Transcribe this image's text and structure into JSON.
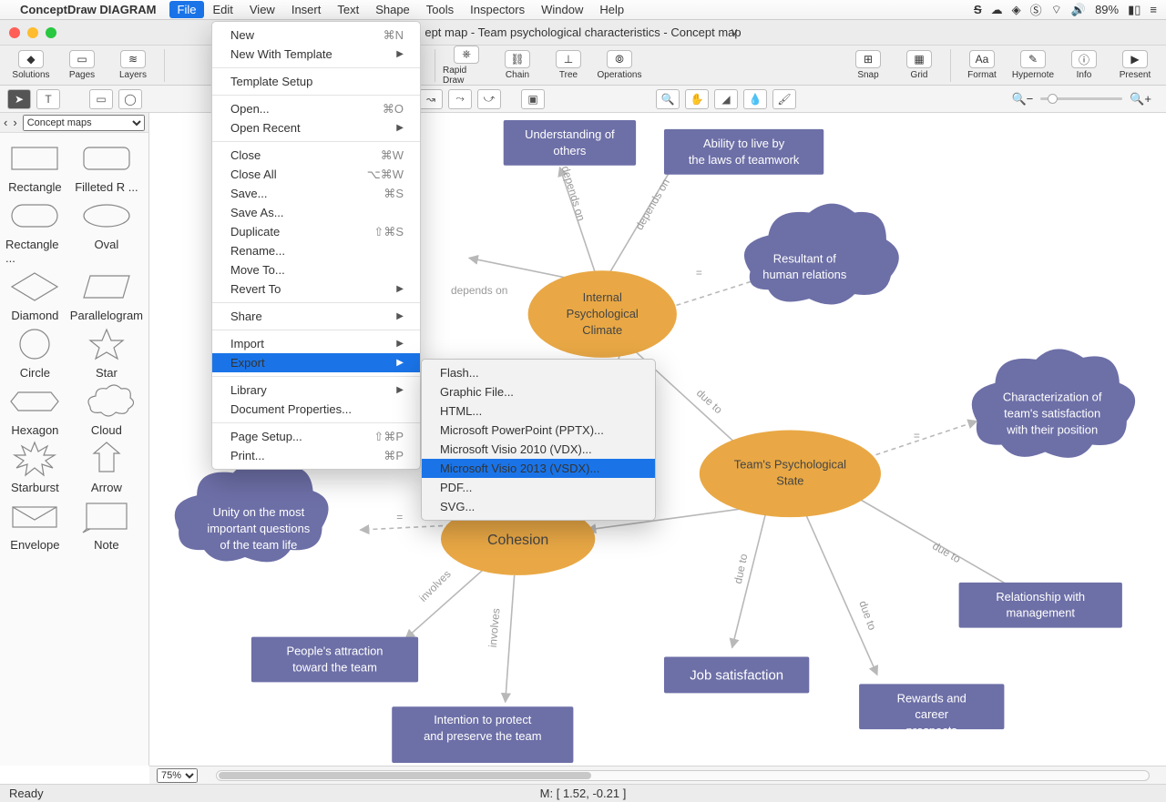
{
  "menubar": {
    "app": "ConceptDraw DIAGRAM",
    "items": [
      "File",
      "Edit",
      "View",
      "Insert",
      "Text",
      "Shape",
      "Tools",
      "Inspectors",
      "Window",
      "Help"
    ],
    "active": "File",
    "battery": "89%"
  },
  "title": "ept map - Team psychological characteristics - Concept map",
  "toolbar": {
    "left": [
      "Solutions",
      "Pages",
      "Layers"
    ],
    "mid": [
      "",
      "Rapid Draw",
      "Chain",
      "Tree",
      "Operations"
    ],
    "right1": [
      "Snap",
      "Grid"
    ],
    "right2": [
      "Format",
      "Hypernote",
      "Info",
      "Present"
    ]
  },
  "sidebar": {
    "title": "Concept maps",
    "shapes": [
      "Rectangle",
      "Filleted R ...",
      "Rectangle ...",
      "Oval",
      "Diamond",
      "Parallelogram",
      "Circle",
      "Star",
      "Hexagon",
      "Cloud",
      "Starburst",
      "Arrow",
      "Envelope",
      "Note"
    ]
  },
  "filemenu": [
    {
      "t": "New",
      "sc": "⌘N"
    },
    {
      "t": "New With Template",
      "sub": true
    },
    {
      "sep": true
    },
    {
      "t": "Template Setup"
    },
    {
      "sep": true
    },
    {
      "t": "Open...",
      "sc": "⌘O"
    },
    {
      "t": "Open Recent",
      "sub": true
    },
    {
      "sep": true
    },
    {
      "t": "Close",
      "sc": "⌘W"
    },
    {
      "t": "Close All",
      "sc": "⌥⌘W"
    },
    {
      "t": "Save...",
      "sc": "⌘S"
    },
    {
      "t": "Save As..."
    },
    {
      "t": "Duplicate",
      "sc": "⇧⌘S"
    },
    {
      "t": "Rename..."
    },
    {
      "t": "Move To..."
    },
    {
      "t": "Revert To",
      "sub": true
    },
    {
      "sep": true
    },
    {
      "t": "Share",
      "sub": true
    },
    {
      "sep": true
    },
    {
      "t": "Import",
      "sub": true
    },
    {
      "t": "Export",
      "sub": true,
      "hi": true
    },
    {
      "sep": true
    },
    {
      "t": "Library",
      "sub": true
    },
    {
      "t": "Document Properties..."
    },
    {
      "sep": true
    },
    {
      "t": "Page Setup...",
      "sc": "⇧⌘P"
    },
    {
      "t": "Print...",
      "sc": "⌘P"
    }
  ],
  "exportmenu": [
    {
      "t": "Flash..."
    },
    {
      "t": "Graphic File..."
    },
    {
      "t": "HTML..."
    },
    {
      "t": "Microsoft PowerPoint (PPTX)..."
    },
    {
      "t": "Microsoft Visio 2010 (VDX)..."
    },
    {
      "t": "Microsoft Visio 2013 (VSDX)...",
      "hi": true
    },
    {
      "t": "PDF..."
    },
    {
      "t": "SVG..."
    }
  ],
  "nodes": {
    "understanding": "Understanding of others",
    "ability": "Ability to live by the laws of teamwork",
    "resultant": "Resultant of human relations",
    "climate": "Internal Psychological Climate",
    "unity": "Unity on the most important questions of the team life",
    "cohesion": "Cohesion",
    "attraction": "People's attraction toward the team",
    "intention": "Intention to protect and preserve the team",
    "state": "Team's Psychological State",
    "characterization": "Characterization of team's satisfaction with their position",
    "job": "Job satisfaction",
    "rewards": "Rewards and career prospects",
    "relationship": "Relationship with management"
  },
  "edges": {
    "depends": "depends on",
    "eq": "=",
    "due": "due to",
    "involves": "involves"
  },
  "bottom": {
    "zoom": "75%",
    "ready": "Ready",
    "mouse": "M: [ 1.52, -0.21 ]"
  }
}
